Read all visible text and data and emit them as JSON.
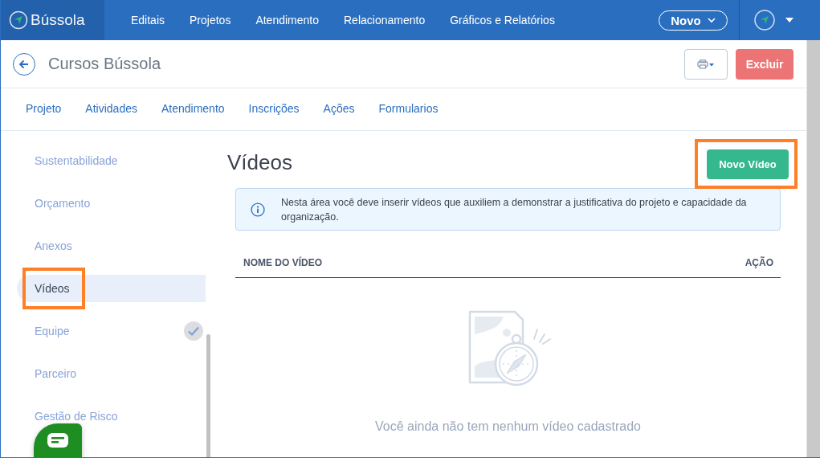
{
  "topbar": {
    "logo": "Bússola",
    "menu": [
      "Editais",
      "Projetos",
      "Atendimento",
      "Relacionamento",
      "Gráficos e Relatórios"
    ],
    "new_button": "Novo"
  },
  "header": {
    "title": "Cursos Bússola",
    "delete_button": "Excluir"
  },
  "tabs": [
    {
      "label": "Projeto",
      "selected": false
    },
    {
      "label": "Atividades",
      "selected": false
    },
    {
      "label": "Atendimento",
      "selected": false
    },
    {
      "label": "Inscrições",
      "selected": false
    },
    {
      "label": "Ações",
      "selected": false
    },
    {
      "label": "Formularios",
      "selected": false
    }
  ],
  "sidebar": {
    "items": [
      {
        "label": "Sustentabilidade",
        "selected": false,
        "done": false,
        "highlighted": false
      },
      {
        "label": "Orçamento",
        "selected": false,
        "done": false,
        "highlighted": false
      },
      {
        "label": "Anexos",
        "selected": false,
        "done": false,
        "highlighted": false
      },
      {
        "label": "Vídeos",
        "selected": true,
        "done": false,
        "highlighted": true
      },
      {
        "label": "Equipe",
        "selected": false,
        "done": true,
        "highlighted": false
      },
      {
        "label": "Parceiro",
        "selected": false,
        "done": false,
        "highlighted": false
      },
      {
        "label": "Gestão de Risco",
        "selected": false,
        "done": false,
        "highlighted": false
      }
    ]
  },
  "main": {
    "title": "Vídeos",
    "new_button": {
      "label": "Novo Vídeo",
      "highlighted": true
    },
    "info": "Nesta área você deve inserir vídeos que auxiliem a demonstrar a justificativa do projeto e capacidade da organização.",
    "table": {
      "columns": [
        "NOME DO VÍDEO",
        "AÇÃO"
      ]
    },
    "empty_message": "Você ainda não tem nenhum vídeo cadastrado"
  }
}
